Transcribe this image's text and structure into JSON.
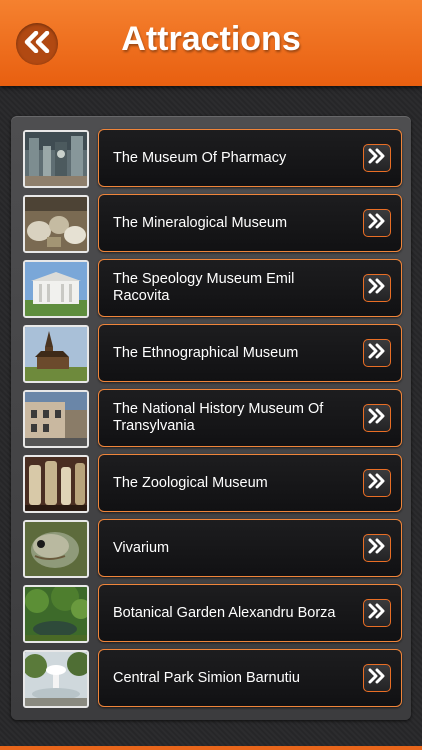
{
  "header": {
    "title": "Attractions",
    "back_icon": "double-chevron-left-icon",
    "accent": "#e8661b"
  },
  "list": {
    "items": [
      {
        "label": "The Museum Of Pharmacy",
        "thumb": "pharmacy-interior-photo",
        "icon": "double-chevron-right-icon"
      },
      {
        "label": "The Mineralogical Museum",
        "thumb": "mineral-specimens-photo",
        "icon": "double-chevron-right-icon"
      },
      {
        "label": "The Speology Museum Emil Racovita",
        "thumb": "white-building-photo",
        "icon": "double-chevron-right-icon"
      },
      {
        "label": "The Ethnographical Museum",
        "thumb": "wooden-church-photo",
        "icon": "double-chevron-right-icon"
      },
      {
        "label": "The National History Museum Of Transylvania",
        "thumb": "street-building-photo",
        "icon": "double-chevron-right-icon"
      },
      {
        "label": "The Zoological Museum",
        "thumb": "specimen-jars-photo",
        "icon": "double-chevron-right-icon"
      },
      {
        "label": "Vivarium",
        "thumb": "fish-photo",
        "icon": "double-chevron-right-icon"
      },
      {
        "label": "Botanical Garden Alexandru Borza",
        "thumb": "garden-pond-photo",
        "icon": "double-chevron-right-icon"
      },
      {
        "label": "Central Park Simion Barnutiu",
        "thumb": "fountain-park-photo",
        "icon": "double-chevron-right-icon"
      }
    ]
  }
}
